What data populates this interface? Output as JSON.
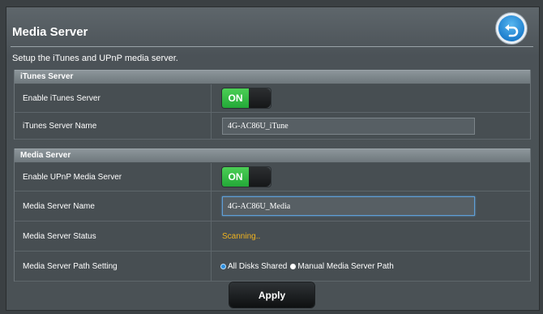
{
  "header": {
    "title": "Media Server",
    "back_icon": "back-arrow-icon"
  },
  "description": "Setup the iTunes and UPnP media server.",
  "itunes_section": {
    "title": "iTunes Server",
    "enable_label": "Enable iTunes Server",
    "enable_toggle": "ON",
    "name_label": "iTunes Server Name",
    "name_value": "4G-AC86U_iTune"
  },
  "media_section": {
    "title": "Media Server",
    "enable_label": "Enable UPnP Media Server",
    "enable_toggle": "ON",
    "name_label": "Media Server Name",
    "name_value": "4G-AC86U_Media",
    "status_label": "Media Server Status",
    "status_value": "Scanning..",
    "path_label": "Media Server Path Setting",
    "path_options": [
      "All Disks Shared",
      "Manual Media Server Path"
    ],
    "path_selected": "All Disks Shared"
  },
  "actions": {
    "apply_label": "Apply"
  },
  "colors": {
    "status": "#f0b31f",
    "toggle_on": "#2fb843",
    "focus": "#5f9fd7"
  }
}
